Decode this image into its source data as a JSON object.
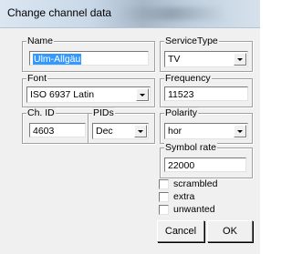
{
  "window": {
    "title": "Change channel data"
  },
  "fields": {
    "name": {
      "label": "Name",
      "value": "Ulm-Allgäu"
    },
    "service_type": {
      "label": "ServiceType",
      "value": "TV"
    },
    "font": {
      "label": "Font",
      "value": "ISO 6937 Latin"
    },
    "frequency": {
      "label": "Frequency",
      "value": "11523"
    },
    "ch_id": {
      "label": "Ch. ID",
      "value": "4603"
    },
    "pids": {
      "label": "PIDs",
      "value": "Dec"
    },
    "polarity": {
      "label": "Polarity",
      "value": "hor"
    },
    "symbol_rate": {
      "label": "Symbol rate",
      "value": "22000"
    }
  },
  "checkboxes": [
    {
      "label": "scrambled",
      "checked": false
    },
    {
      "label": "extra",
      "checked": false
    },
    {
      "label": "unwanted",
      "checked": false
    }
  ],
  "buttons": {
    "cancel": "Cancel",
    "ok": "OK"
  }
}
